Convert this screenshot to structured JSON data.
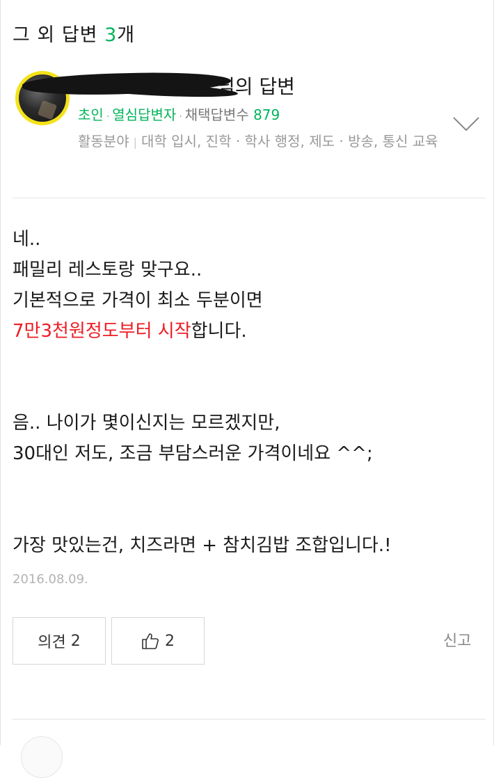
{
  "header": {
    "prefix": "그 외 답변 ",
    "count": "3",
    "suffix": "개"
  },
  "answer": {
    "author_suffix": "님의 답변",
    "rank": "초인",
    "badge": "열심답변자",
    "adopted_label": "채택답변수",
    "adopted_count": "879",
    "field_label": "활동분야",
    "fields": "대학 입시, 진학 · 학사 행정, 제도 · 방송, 통신 교육",
    "body": {
      "line1": "네..",
      "line2": "패밀리 레스토랑 맞구요..",
      "line3": "기본적으로 가격이 최소 두분이면",
      "line4_highlight": "7만3천원정도부터 시작",
      "line4_rest": "합니다.",
      "line5": "음.. 나이가 몇이신지는 모르겠지만,",
      "line6": "30대인 저도, 조금 부담스러운 가격이네요 ^^;",
      "line7": "가장 맛있는건, 치즈라면 + 참치김밥 조합입니다.!"
    },
    "date": "2016.08.09.",
    "opinion_label": "의견",
    "opinion_count": "2",
    "like_count": "2",
    "report_label": "신고"
  },
  "colors": {
    "accent_green": "#00b45a",
    "highlight_red": "#ee1c24",
    "avatar_ring": "#f4e21a"
  },
  "icons": [
    "chevron-down-icon",
    "thumbs-up-icon"
  ]
}
